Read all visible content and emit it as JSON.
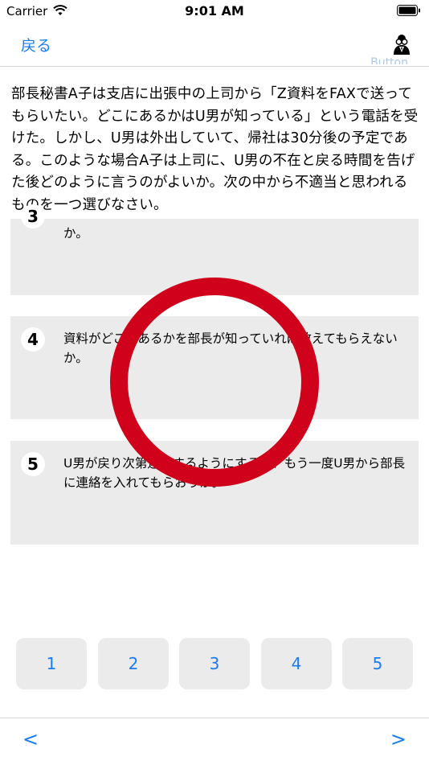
{
  "status": {
    "carrier": "Carrier",
    "time": "9:01 AM"
  },
  "nav": {
    "back_label": "戻る",
    "ghost_label": "Button",
    "right_icon": "person-glasses-icon"
  },
  "question": "部長秘書A子は支店に出張中の上司から「Z資料をFAXで送ってもらいたい。どこにあるかはU男が知っている」という電話を受けた。しかし、U男は外出していて、帰社は30分後の予定である。このような場合A子は上司に、U男の不在と戻る時間を告げた後どのように言うのがよいか。次の中から不適当と思われるものを一つ選びなさい。",
  "choices": [
    {
      "number": "3",
      "text": "か。"
    },
    {
      "number": "4",
      "text": "資料がどこにあるかを部長が知っていれば教えてもらえないか。"
    },
    {
      "number": "5",
      "text": "U男が戻り次第連絡するようにするか、もう一度U男から部長に連絡を入れてもらおうか。"
    }
  ],
  "overlay": {
    "mark": "correct-circle",
    "color": "#d0021b"
  },
  "answers": [
    "1",
    "2",
    "3",
    "4",
    "5"
  ],
  "bottom": {
    "prev_label": "<",
    "next_label": ">"
  },
  "colors": {
    "accent": "#1a7cf0",
    "card": "#ebebeb",
    "mark": "#d0021b"
  }
}
